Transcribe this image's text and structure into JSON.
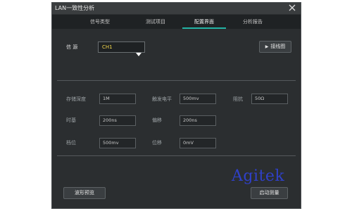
{
  "window": {
    "title": "LAN一致性分析"
  },
  "tabs": [
    {
      "label": "信号类型"
    },
    {
      "label": "测试项目"
    },
    {
      "label": "配置界面"
    },
    {
      "label": "分析报告"
    }
  ],
  "source": {
    "label": "信 源",
    "value": "CH1"
  },
  "buttons": {
    "wiring": "接线图",
    "preview": "波形预览",
    "start": "启动测量"
  },
  "params": {
    "storage_depth": {
      "label": "存储深度",
      "value": "1M"
    },
    "trigger_level": {
      "label": "触发电平",
      "value": "500mv"
    },
    "impedance": {
      "label": "阻抗",
      "value": "50Ω"
    },
    "timebase": {
      "label": "时基",
      "value": "200ns"
    },
    "offset": {
      "label": "偏移",
      "value": "200ns"
    },
    "scale": {
      "label": "档位",
      "value": "500mv"
    },
    "shift": {
      "label": "位移",
      "value": "0mV"
    }
  },
  "watermark": {
    "text": "Agitek"
  }
}
